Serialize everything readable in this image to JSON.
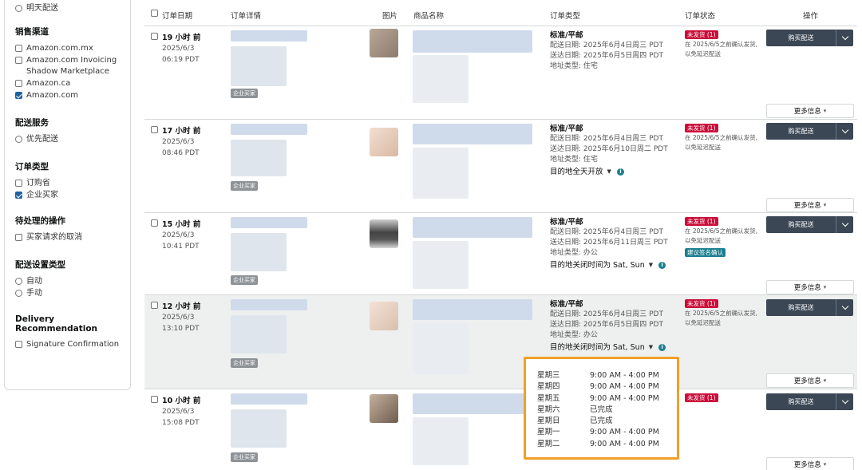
{
  "filters": {
    "top_option": "明天配送",
    "sales_channel": {
      "title": "销售渠道",
      "options": [
        {
          "label": "Amazon.com.mx",
          "checked": false
        },
        {
          "label": "Amazon.com Invoicing Shadow Marketplace",
          "checked": false
        },
        {
          "label": "Amazon.ca",
          "checked": false
        },
        {
          "label": "Amazon.com",
          "checked": true
        }
      ]
    },
    "delivery_service": {
      "title": "配送服务",
      "options": [
        {
          "label": "优先配送"
        }
      ]
    },
    "order_type": {
      "title": "订单类型",
      "options": [
        {
          "label": "订购省",
          "checked": false
        },
        {
          "label": "企业买家",
          "checked": true
        }
      ]
    },
    "pending_actions": {
      "title": "待处理的操作",
      "options": [
        {
          "label": "买家请求的取消",
          "checked": false
        }
      ]
    },
    "shipping_setting": {
      "title": "配送设置类型",
      "options": [
        {
          "label": "自动"
        },
        {
          "label": "手动"
        }
      ]
    },
    "delivery_recommendation": {
      "title": "Delivery Recommendation",
      "options": [
        {
          "label": "Signature Confirmation",
          "checked": false
        }
      ]
    }
  },
  "table": {
    "headers": {
      "order_date": "订单日期",
      "order_details": "订单详情",
      "image": "图片",
      "product_name": "商品名称",
      "order_type": "订单类型",
      "order_status": "订单状态",
      "actions": "操作"
    },
    "business_badge": "企业买家",
    "buy_shipping": "购买配送",
    "more_info": "更多信息",
    "rows": [
      {
        "time_ago": "19 小时 前",
        "date": "2025/6/3",
        "time": "06:19 PDT",
        "type_title": "标准/平邮",
        "ship_date": "配送日期: 2025年6月4日周三 PDT",
        "arrive_date": "送达日期: 2025年6月5日周四 PDT",
        "addr_type": "地址类型: 住宅",
        "dest": "",
        "status_badge": "未发货 (1)",
        "status_line1": "在 2025/6/5之前确认发货,",
        "status_line2": "以免延迟配送",
        "extra_badge": ""
      },
      {
        "time_ago": "17 小时 前",
        "date": "2025/6/3",
        "time": "08:46 PDT",
        "type_title": "标准/平邮",
        "ship_date": "配送日期: 2025年6月4日周三 PDT",
        "arrive_date": "送达日期: 2025年6月10日周二 PDT",
        "addr_type": "地址类型: 住宅",
        "dest": "目的地全天开放",
        "status_badge": "未发货 (1)",
        "status_line1": "在 2025/6/5之前确认发货,",
        "status_line2": "以免延迟配送",
        "extra_badge": ""
      },
      {
        "time_ago": "15 小时 前",
        "date": "2025/6/3",
        "time": "10:41 PDT",
        "type_title": "标准/平邮",
        "ship_date": "配送日期: 2025年6月4日周三 PDT",
        "arrive_date": "送达日期: 2025年6月11日周三 PDT",
        "addr_type": "地址类型: 办公",
        "dest": "目的地关闭时间为 Sat, Sun",
        "status_badge": "未发货 (1)",
        "status_line1": "在 2025/6/5之前确认发货,",
        "status_line2": "以免延迟配送",
        "extra_badge": "建议签名确认"
      },
      {
        "time_ago": "12 小时 前",
        "date": "2025/6/3",
        "time": "13:10 PDT",
        "type_title": "标准/平邮",
        "ship_date": "配送日期: 2025年6月4日周三 PDT",
        "arrive_date": "送达日期: 2025年6月5日周四 PDT",
        "addr_type": "地址类型: 办公",
        "dest": "目的地关闭时间为 Sat, Sun",
        "status_badge": "未发货 (1)",
        "status_line1": "在 2025/6/5之前确认发货,",
        "status_line2": "以免延迟配送",
        "extra_badge": ""
      },
      {
        "time_ago": "10 小时 前",
        "date": "2025/6/3",
        "time": "15:08 PDT",
        "type_title": "",
        "ship_date": "",
        "arrive_date": "",
        "addr_type": "",
        "dest": "",
        "status_badge": "未发货 (1)",
        "status_line1": "",
        "status_line2": "",
        "extra_badge": ""
      }
    ]
  },
  "hours_popover": [
    {
      "day": "星期三",
      "hours": "9:00 AM - 4:00 PM"
    },
    {
      "day": "星期四",
      "hours": "9:00 AM - 4:00 PM"
    },
    {
      "day": "星期五",
      "hours": "9:00 AM - 4:00 PM"
    },
    {
      "day": "星期六",
      "hours": "已完成"
    },
    {
      "day": "星期日",
      "hours": "已完成"
    },
    {
      "day": "星期一",
      "hours": "9:00 AM - 4:00 PM"
    },
    {
      "day": "星期二",
      "hours": "9:00 AM - 4:00 PM"
    }
  ]
}
